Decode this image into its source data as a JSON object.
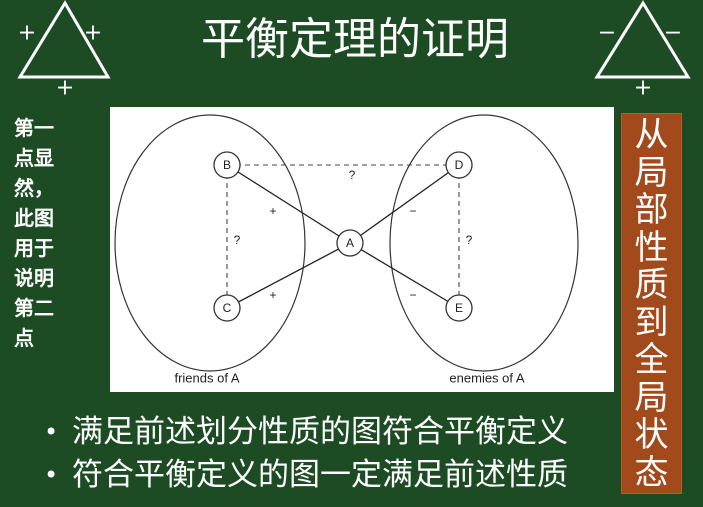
{
  "title": "平衡定理的证明",
  "triangle_left": {
    "signs": [
      "+",
      "+",
      "+"
    ]
  },
  "triangle_right": {
    "signs": [
      "−",
      "−",
      "+"
    ]
  },
  "side_note": {
    "lines": [
      "第一",
      "点显",
      "然，",
      "此图",
      "用于",
      "说明",
      "第二",
      "点"
    ]
  },
  "diagram": {
    "nodes": {
      "A": "A",
      "B": "B",
      "C": "C",
      "D": "D",
      "E": "E"
    },
    "edge_labels": {
      "b_d": "?",
      "b_c": "?",
      "d_e": "?",
      "b_a": "+",
      "c_a": "+",
      "d_a": "−",
      "e_a": "−"
    },
    "groups": {
      "friends": "friends of A",
      "enemies": "enemies of A"
    }
  },
  "callout": {
    "text": "从局部性质到全局状态"
  },
  "bullets": {
    "marker": "•",
    "items": [
      "满足前述划分性质的图符合平衡定义",
      "符合平衡定义的图一定满足前述性质"
    ]
  },
  "colors": {
    "background": "#1d4b24",
    "callout": "#a34a1d",
    "text": "#ffffff"
  }
}
